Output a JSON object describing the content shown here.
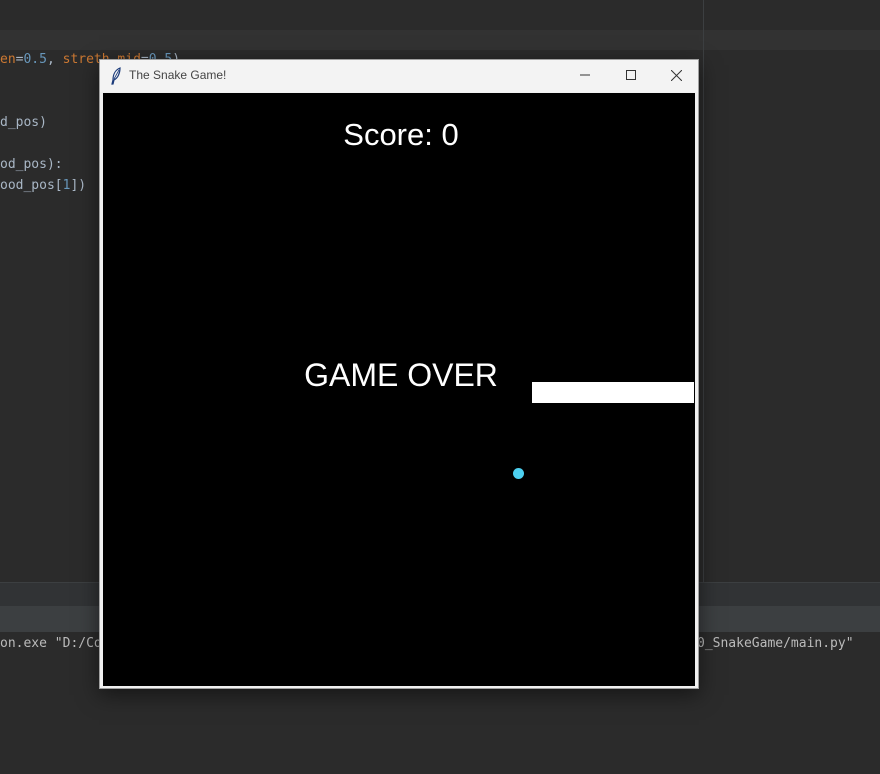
{
  "ide": {
    "code_lines": [
      {
        "parts": [
          {
            "t": "en",
            "c": "kw"
          },
          {
            "t": "=",
            "c": ""
          },
          {
            "t": "0.5",
            "c": "num"
          },
          {
            "t": ", ",
            "c": ""
          },
          {
            "t": "stret",
            "c": "kw"
          },
          {
            "t": "h_mid",
            "c": "kw"
          },
          {
            "t": "=",
            "c": ""
          },
          {
            "t": "0.5",
            "c": "num"
          },
          {
            "t": ")",
            "c": ""
          }
        ]
      },
      {
        "parts": [
          {
            "t": "d_pos)",
            "c": ""
          }
        ]
      },
      {
        "parts": [
          {
            "t": "od_pos):",
            "c": ""
          }
        ]
      },
      {
        "parts": [
          {
            "t": "ood_pos[",
            "c": ""
          },
          {
            "t": "1",
            "c": "num"
          },
          {
            "t": "])",
            "c": ""
          }
        ]
      }
    ],
    "console_left": "on.exe \"D:/Co",
    "console_right": "0_SnakeGame/main.py\""
  },
  "window": {
    "title": "The Snake Game!",
    "minimize_symbol": "─",
    "maximize_symbol": "☐",
    "close_symbol": "✕"
  },
  "game": {
    "score_text": "Score: 0",
    "status_text": "GAME OVER",
    "background_color": "#000000",
    "snake_color": "#ffffff",
    "food_color": "#4dd0f0"
  }
}
